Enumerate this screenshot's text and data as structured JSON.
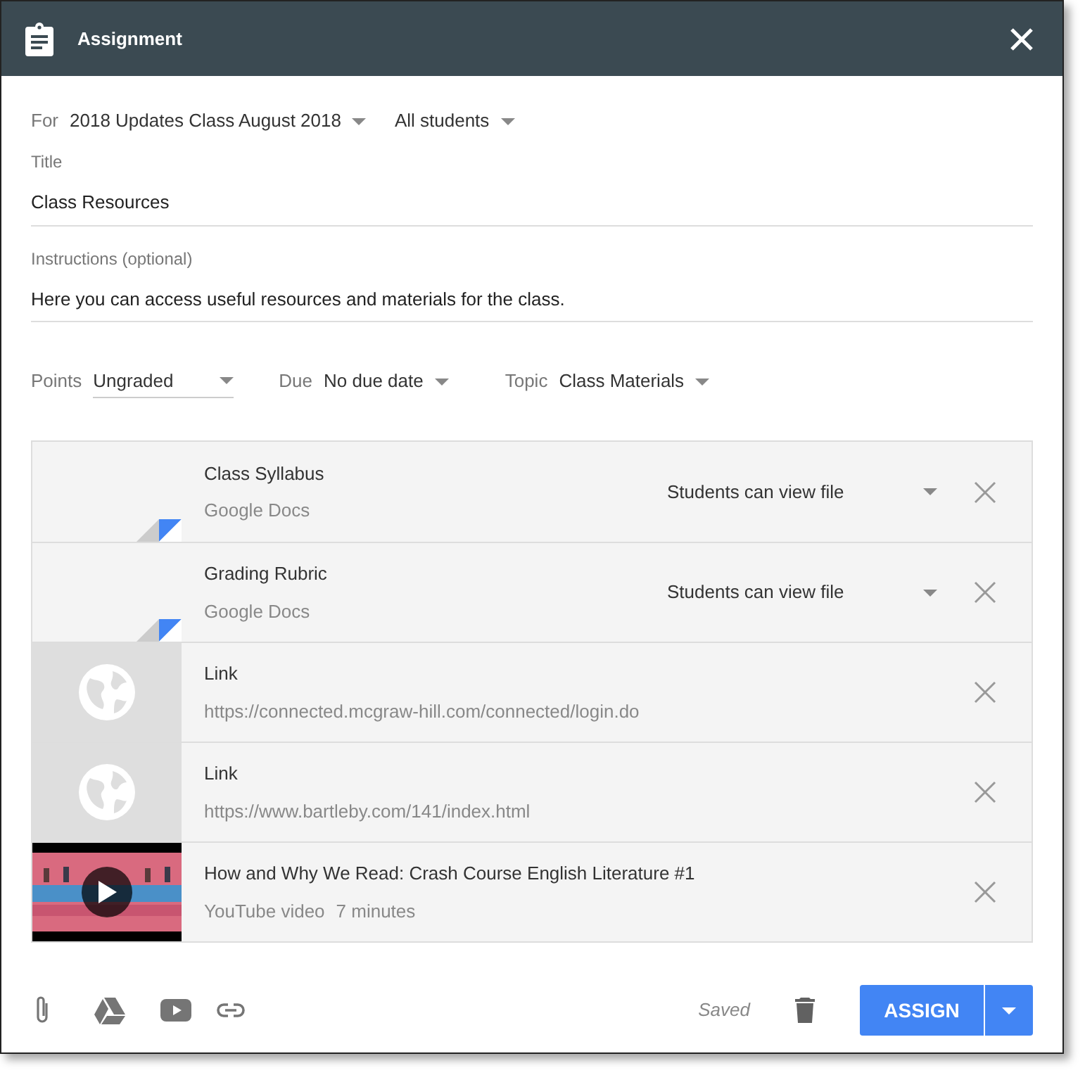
{
  "header": {
    "title": "Assignment"
  },
  "for": {
    "label": "For",
    "class": "2018 Updates Class August 2018",
    "students": "All students"
  },
  "title": {
    "label": "Title",
    "value": "Class Resources"
  },
  "instructions": {
    "label": "Instructions (optional)",
    "value": "Here you can access useful resources and materials for the class."
  },
  "points": {
    "label": "Points",
    "value": "Ungraded"
  },
  "due": {
    "label": "Due",
    "value": "No due date"
  },
  "topic": {
    "label": "Topic",
    "value": "Class Materials"
  },
  "attachments": [
    {
      "kind": "doc",
      "title": "Class Syllabus",
      "subtitle": "Google Docs",
      "permission": "Students can view file"
    },
    {
      "kind": "doc",
      "title": "Grading Rubric",
      "subtitle": "Google Docs",
      "permission": "Students can view file"
    },
    {
      "kind": "link",
      "title": "Link",
      "subtitle": "https://connected.mcgraw-hill.com/connected/login.do"
    },
    {
      "kind": "link",
      "title": "Link",
      "subtitle": "https://www.bartleby.com/141/index.html"
    },
    {
      "kind": "video",
      "title": "How and Why We Read: Crash Course English Literature #1",
      "subtitle": "YouTube video",
      "duration": "7 minutes"
    }
  ],
  "footer": {
    "status": "Saved",
    "assign": "ASSIGN"
  }
}
